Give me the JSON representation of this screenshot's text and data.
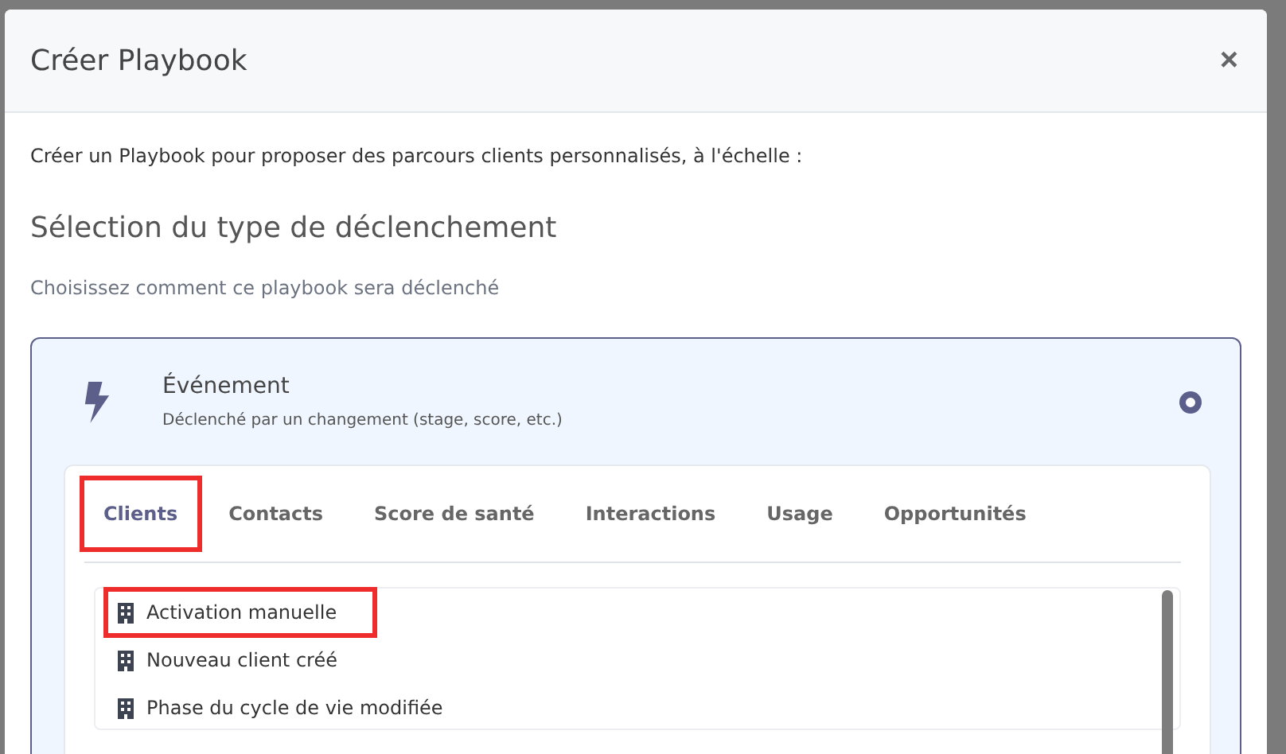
{
  "dialog": {
    "title": "Créer Playbook",
    "close": "×"
  },
  "intro": "Créer un Playbook pour proposer des parcours clients personnalisés, à l'échelle :",
  "section": {
    "title": "Sélection du type de déclenchement",
    "subtitle": "Choisissez comment ce playbook sera déclenché"
  },
  "option": {
    "title": "Événement",
    "description": "Déclenché par un changement (stage, score, etc.)",
    "selected": true
  },
  "tabs": [
    {
      "label": "Clients",
      "selected": true,
      "highlighted": true
    },
    {
      "label": "Contacts",
      "selected": false,
      "highlighted": false
    },
    {
      "label": "Score de santé",
      "selected": false,
      "highlighted": false
    },
    {
      "label": "Interactions",
      "selected": false,
      "highlighted": false
    },
    {
      "label": "Usage",
      "selected": false,
      "highlighted": false
    },
    {
      "label": "Opportunités",
      "selected": false,
      "highlighted": false
    }
  ],
  "triggers": [
    {
      "label": "Activation manuelle",
      "highlighted": true
    },
    {
      "label": "Nouveau client créé",
      "highlighted": false
    },
    {
      "label": "Phase du cycle de vie modifiée",
      "highlighted": false
    }
  ]
}
